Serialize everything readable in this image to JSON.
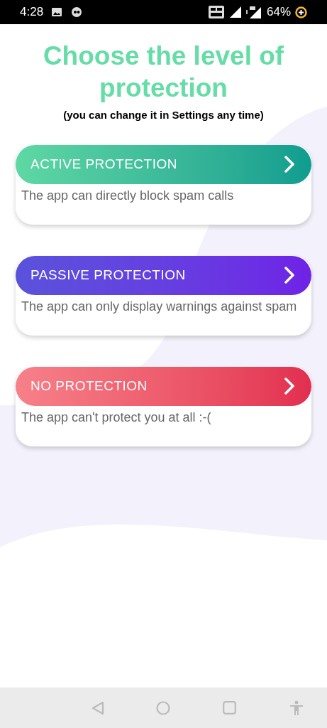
{
  "status_bar": {
    "time": "4:28",
    "battery": "64%"
  },
  "title": "Choose the level of protection",
  "subtitle": "(you can change it in Settings any time)",
  "options": [
    {
      "kind": "active",
      "label": "ACTIVE PROTECTION",
      "description": "The app can directly block spam calls"
    },
    {
      "kind": "passive",
      "label": "PASSIVE PROTECTION",
      "description": "The app can only display warnings against spam"
    },
    {
      "kind": "none",
      "label": "NO PROTECTION",
      "description": "The app can't protect you at all :-("
    }
  ]
}
